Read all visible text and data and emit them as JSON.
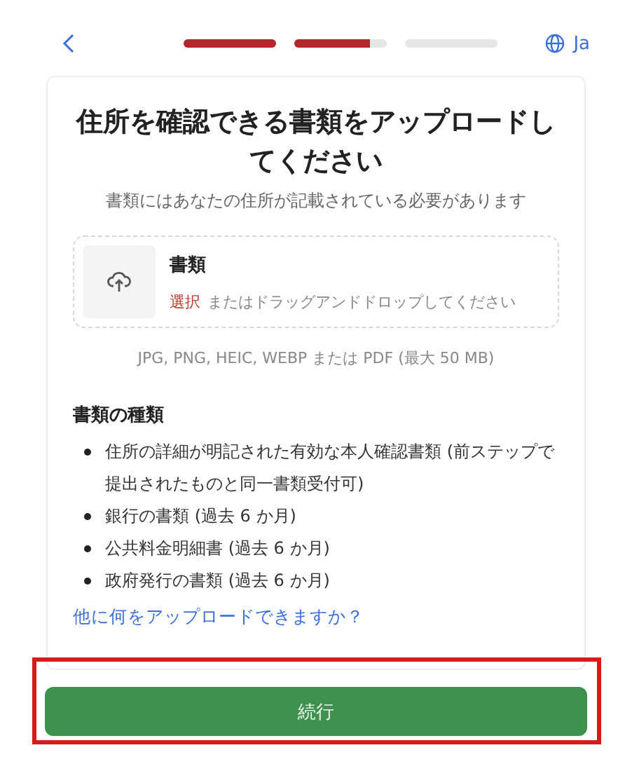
{
  "header": {
    "language": "Ja"
  },
  "progress": [
    {
      "kind": "complete"
    },
    {
      "kind": "current",
      "level": 0.82
    },
    {
      "kind": "pending"
    }
  ],
  "title": "住所を確認できる書類をアップロードしてください",
  "subtitle": "書類にはあなたの住所が記載されている必要があります",
  "upload": {
    "label": "書類",
    "action": "選択",
    "hint": "またはドラッグアンドドロップしてください"
  },
  "formats": "JPG, PNG, HEIC, WEBP または PDF (最大 50 MB)",
  "document_types": {
    "heading": "書類の種類",
    "items": [
      "住所の詳細が明記された有効な本人確認書類 (前ステップで提出されたものと同一書類受付可)",
      "銀行の書類 (過去 6 か月)",
      "公共料金明細書 (過去 6 か月)",
      "政府発行の書類 (過去 6 か月)"
    ]
  },
  "help_link": "他に何をアップロードできますか？",
  "continue_button": {
    "label": "続行",
    "highlighted": true
  }
}
